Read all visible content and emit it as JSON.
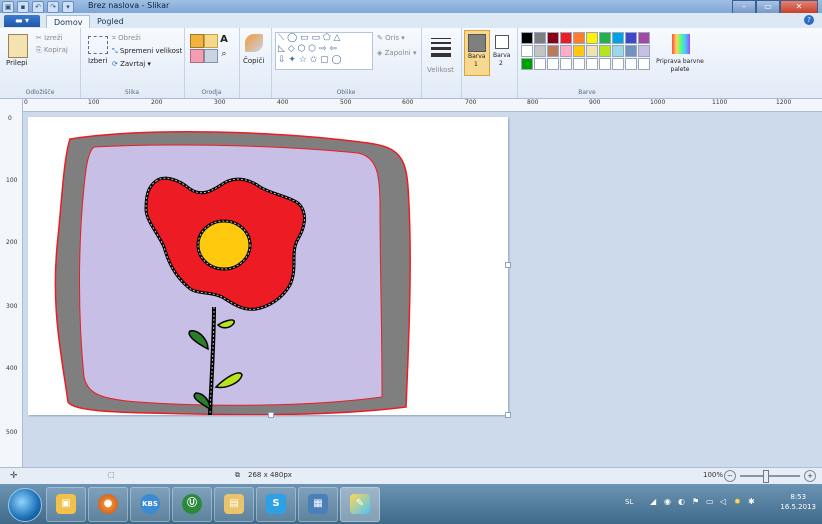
{
  "window": {
    "title": "Brez naslova - Slikar",
    "minimize": "–",
    "maximize": "▭",
    "close": "✕"
  },
  "tabs": {
    "file": "▬ ▾",
    "home": "Domov",
    "view": "Pogled"
  },
  "clipboard": {
    "paste": "Prilepi",
    "cut": "Izreži",
    "copy": "Kopiraj",
    "label": "Odložišče"
  },
  "image": {
    "select": "Izberi",
    "crop": "Obreži",
    "resize": "Spremeni velikost",
    "rotate": "Zavrtaj ▾",
    "label": "Slika"
  },
  "tools": {
    "label": "Orodja"
  },
  "brushes": {
    "label": "Čopiči"
  },
  "shapes": {
    "outline": "Oris ▾",
    "fill": "Zapolni ▾",
    "label": "Oblike",
    "row1": "⟍ ◯ ▭ ▭ ⬠ △",
    "row2": "◺ ◇ ⬡ ⬡ ⇨ ⇦",
    "row3": "⇩ ✦ ☆ ✩ ▢ ◯"
  },
  "size": {
    "label": "Velikost"
  },
  "color1": {
    "label": "Barva",
    "num": "1"
  },
  "color2": {
    "label": "Barva",
    "num": "2"
  },
  "colors": {
    "label": "Barve",
    "edit": "Priprava barvne palete"
  },
  "palette": {
    "row1": [
      "#000000",
      "#7f7f7f",
      "#880015",
      "#ed1c24",
      "#ff7f27",
      "#fff200",
      "#22b14c",
      "#00a2e8",
      "#3f48cc",
      "#a349a4"
    ],
    "row2": [
      "#ffffff",
      "#c3c3c3",
      "#b97a57",
      "#ffaec9",
      "#ffc90e",
      "#efe4b0",
      "#b5e61d",
      "#99d9ea",
      "#7092be",
      "#c8bfe7"
    ],
    "row3": [
      "#00a000",
      "#ffffff",
      "#ffffff",
      "#ffffff",
      "#ffffff",
      "#ffffff",
      "#ffffff",
      "#ffffff",
      "#ffffff",
      "#ffffff"
    ]
  },
  "ruler_h": [
    "0",
    "100",
    "200",
    "300",
    "400",
    "500",
    "600",
    "700",
    "800",
    "900",
    "1000",
    "1100",
    "1200"
  ],
  "ruler_v": [
    "0",
    "100",
    "200",
    "300",
    "400",
    "500"
  ],
  "status": {
    "size": "268 x 480px",
    "zoom": "100%",
    "zoom_minus": "−",
    "zoom_plus": "+"
  },
  "taskbar": {
    "lang": "SL",
    "time": "8:53",
    "date": "16.5.2013"
  },
  "accent": "#2b6cc4"
}
